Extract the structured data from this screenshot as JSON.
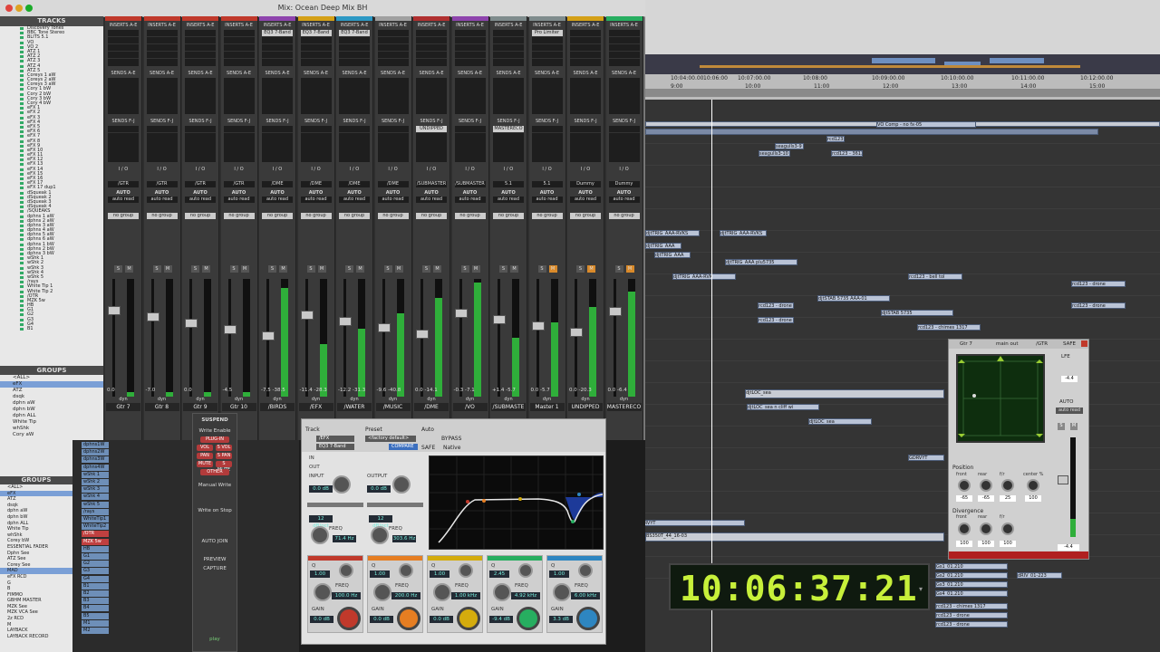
{
  "mix_window": {
    "title": "Mix: Ocean Deep Mix BH",
    "tracks_header": "TRACKS",
    "groups_header": "GROUPS",
    "tracks": [
      "Discovery Tones",
      "BBC Tone Stereo",
      "BLITS 5.1",
      "VO",
      "VO 2",
      "ATZ 1",
      "ATZ 2",
      "ATZ 3",
      "ATZ 4",
      "ATZ 5",
      "Coreys 1 aW",
      "Coreys 2 aW",
      "Coreys 3 aW",
      "Cory 1 bW",
      "Cory 2 bW",
      "Cory 3 bW",
      "Cory 4 bW",
      "eFX 1",
      "eFX 2",
      "eFX 3",
      "eFX 4",
      "eFX 5",
      "eFX 6",
      "eFX 7",
      "eFX 8",
      "eFX 9",
      "eFX 10",
      "eFX 11",
      "eFX 12",
      "eFX 13",
      "eFX 14",
      "eFX 15",
      "eFX 16",
      "eFX 17",
      "eFX 17 dup1",
      "dSqueak 1",
      "dSqueak 2",
      "dSqueak 3",
      "dSqueak 4",
      "/SQUEAKS",
      "dphns 1 aW",
      "dphns 2 aW",
      "dphns 3 aW",
      "dphns 4 aW",
      "dphns 5 aW",
      "dphns 6 aW",
      "dphns 1 bW",
      "dphns 2 bW",
      "dphns 3 bW",
      "wShk 1",
      "wShk 2",
      "wShk 3",
      "wShk 4",
      "wShk 5",
      "/rays",
      "White Tip 1",
      "White Tip 2",
      "/OTR",
      "MZK 5w",
      "HB",
      "G1",
      "G2",
      "G3",
      "G4",
      "B1"
    ],
    "groups": [
      "<ALL>",
      "eFX",
      "ATZ",
      "dsqk",
      "dphn aW",
      "dphn bW",
      "dphn ALL",
      "White Tip",
      "whShk",
      "Cory aW"
    ],
    "strips": [
      {
        "name": "Gtr 7",
        "color": "#c0392b",
        "volume": "0.0",
        "insert": "",
        "send": "",
        "output": "/GTR",
        "auto": "AUTO",
        "autoread": "auto read",
        "group": "no group"
      },
      {
        "name": "Gtr 8",
        "color": "#c0392b",
        "volume": "-7.0",
        "insert": "",
        "send": "",
        "output": "/GTR",
        "auto": "AUTO",
        "autoread": "auto read",
        "group": "no group"
      },
      {
        "name": "Gtr 9",
        "color": "#c0392b",
        "volume": "0.0",
        "insert": "",
        "send": "",
        "output": "/GTR",
        "auto": "AUTO",
        "autoread": "auto read",
        "group": "no group"
      },
      {
        "name": "Gtr 10",
        "color": "#c0392b",
        "volume": "-4.5",
        "insert": "",
        "send": "",
        "output": "/GTR",
        "auto": "AUTO",
        "autoread": "auto read",
        "group": "no group"
      },
      {
        "name": "/BIRDS",
        "color": "#8e44ad",
        "volume": "-7.5 -38.5",
        "insert": "EQ3 7-Band",
        "send": "",
        "output": "/DME",
        "auto": "AUTO",
        "autoread": "auto read",
        "group": "no group"
      },
      {
        "name": "/EFX",
        "color": "#d4a017",
        "volume": "-11.4 -28.3",
        "insert": "EQ3 7-Band",
        "send": "",
        "output": "/DME",
        "auto": "AUTO",
        "autoread": "auto read",
        "group": "no group"
      },
      {
        "name": "/WATER",
        "color": "#2c98c4",
        "volume": "-12.2 -31.3",
        "insert": "EQ3 7-Band",
        "send": "",
        "output": "/DME",
        "auto": "AUTO",
        "autoread": "auto read",
        "group": "no group"
      },
      {
        "name": "/MUSIC",
        "color": "#a0a0a0",
        "volume": "-9.6 -40.8",
        "insert": "",
        "send": "",
        "output": "/DME",
        "auto": "AUTO",
        "autoread": "auto read",
        "group": "no group"
      },
      {
        "name": "/DME",
        "color": "#b03030",
        "volume": "0.0 -14.1",
        "insert": "",
        "send": "UNDIPPED",
        "output": "/SUBMASTER",
        "auto": "AUTO",
        "autoread": "auto read",
        "group": "no group"
      },
      {
        "name": "/VO",
        "color": "#8e44ad",
        "volume": "-0.3 -7.1",
        "insert": "",
        "send": "",
        "output": "/SUBMASTER",
        "auto": "AUTO",
        "autoread": "auto read",
        "group": "no group"
      },
      {
        "name": "/SUBMASTE",
        "color": "#7f8c8d",
        "volume": "+1.4 -5.7",
        "insert": "",
        "send": "MASTERECO",
        "output": "5.1",
        "auto": "AUTO",
        "autoread": "auto read",
        "group": "no group"
      },
      {
        "name": "Master 1",
        "color": "#7f8c8d",
        "volume": "0.0 -5.7",
        "insert": "Pro Limiter",
        "send": "",
        "output": "5.1",
        "auto": "AUTO",
        "autoread": "auto read",
        "group": "no group"
      },
      {
        "name": "UNDIPPED",
        "color": "#d4a017",
        "volume": "0.0 -20.3",
        "insert": "",
        "send": "",
        "output": "Dummy",
        "auto": "AUTO",
        "autoread": "auto read",
        "group": "no group"
      },
      {
        "name": "MASTERECO",
        "color": "#27ae60",
        "volume": "0.0 -6.4",
        "insert": "",
        "send": "",
        "output": "Dummy",
        "auto": "AUTO",
        "autoread": "auto read",
        "group": "no group"
      }
    ],
    "labels": {
      "inserts": "INSERTS A-E",
      "sends_ae": "SENDS A-E",
      "sends_fj": "SENDS F-J",
      "io": "I / O",
      "vol": "vol",
      "dyn": "dyn"
    }
  },
  "lower_window": {
    "groups_header": "GROUPS",
    "groups": [
      "<ALL>",
      "eFX",
      "ATZ",
      "dsqk",
      "dphn aW",
      "dphn bW",
      "dphn ALL",
      "White Tip",
      "whShk",
      "Corey bW",
      "ESSENTIAL FADER",
      "Dphn See",
      "ATZ See",
      "Corey See",
      "MAD",
      "eFX RCD",
      "G",
      "B",
      "FIMMO",
      "GBHM MASTER",
      "MZK See",
      "MZK VCA See",
      "2z RCD",
      "M",
      "LAYBACK",
      "LAYBACK RECORD"
    ],
    "tracks": [
      "dphns1W",
      "dphns2W",
      "dphns3W",
      "dphns4W",
      "wShk 1",
      "wShk 2",
      "wShk 3",
      "wShk 4",
      "wShk 5",
      "/rays",
      "WhiteTip1",
      "WhiteTip2",
      "/OTR",
      "MZK 5w",
      "HB",
      "G1",
      "G2",
      "G3",
      "G4",
      "B1",
      "B2",
      "B3",
      "B4",
      "B5",
      "M1",
      "M2"
    ],
    "automation": {
      "suspend": "SUSPEND",
      "write_enable": "Write Enable",
      "plugin": "PLUG-IN",
      "vol": "VOL",
      "s_vol": "S VOL",
      "pan": "PAN",
      "s_pan": "S PAN",
      "mute": "MUTE",
      "s_mute": "S MUTE",
      "other": "OTHER",
      "manual_write": "Manual Write",
      "write_on_stop": "Write on Stop",
      "auto_join": "AUTO JOIN",
      "preview": "PREVIEW",
      "capture": "CAPTURE",
      "play": "play",
      "volume": "volume"
    }
  },
  "eq_plugin": {
    "track_label": "Track",
    "preset_label": "Preset",
    "auto_label": "Auto",
    "track": "/EFX",
    "preset": "<factory default>",
    "insert": "EQ3 7-Band",
    "bypass": "BYPASS",
    "compare": "COMPARE",
    "safe": "SAFE",
    "native": "Native",
    "input_label": "INPUT",
    "output_label": "OUTPUT",
    "input": "0.0 dB",
    "output": "0.0 dB",
    "hpf": {
      "slope": "12 dB/oct",
      "freq": "71.4 Hz"
    },
    "lpf": {
      "slope": "12 dB/oct",
      "freq": "303.6 Hz"
    },
    "bands": [
      {
        "q": "1.00",
        "freq": "100.0 Hz",
        "gain": "0.0 dB",
        "color": "#c0392b"
      },
      {
        "q": "1.00",
        "freq": "200.0 Hz",
        "gain": "0.0 dB",
        "color": "#e67e22"
      },
      {
        "q": "1.00",
        "freq": "1.00 kHz",
        "gain": "0.0 dB",
        "color": "#d4ac0d"
      },
      {
        "q": "2.45",
        "freq": "4.92 kHz",
        "gain": "-9.4 dB",
        "color": "#27ae60"
      },
      {
        "q": "1.00",
        "freq": "6.00 kHz",
        "gain": "3.3 dB",
        "color": "#2e86c1"
      }
    ],
    "labels": {
      "q": "Q",
      "freq": "FREQ",
      "gain": "GAIN",
      "in": "IN",
      "out": "OUT"
    }
  },
  "panner": {
    "track": "Gtr 7",
    "output": "main out",
    "out2": "/GTR",
    "safe": "SAFE",
    "lfe": "LFE",
    "auto": "AUTO",
    "autoread": "auto read",
    "position": "Position",
    "front": "front",
    "rear": "rear",
    "fr": "f/r",
    "center": "center %",
    "values_pos": [
      "-65",
      "-65",
      "25",
      "100"
    ],
    "divergence": "Divergence",
    "div_front": "front",
    "div_rear": "rear",
    "div_fr": "f/r",
    "values_div": [
      "100",
      "100",
      "100"
    ],
    "lfe_val": "-4.4"
  },
  "timecode": {
    "display": "10:06:37:21"
  },
  "edit_window": {
    "ruler_times": [
      "10:04:00.00",
      "10:06:00",
      "10:07:00.00",
      "10:08:00",
      "10:09:00.00",
      "10:10:00.00",
      "10:11:00.00",
      "10:12:00.00"
    ],
    "ruler_times2": [
      "9:00",
      "10:00",
      "11:00",
      "12:00",
      "13:00",
      "14:00",
      "15:00"
    ],
    "clips": [
      "VO Comp - no fx-05",
      "seagulls3-9",
      "seagulls3-10",
      "rcd123",
      "rcd123 - 3613",
      "djtTRIG_AAA-RVKS",
      "djtTRIG_AAA",
      "djtTRIG_AAA-RVK",
      "djtTRIG_AAA plu5735",
      "djtSTAB 5735",
      "djtSTAB 5735 AAA-01",
      "djtLOC_sea",
      "djtLOC_sea n cliff wi",
      "GDRVYT",
      "BS350T_44_16-03",
      "rcd123 - drone",
      "rcd123 - chimes 1317",
      "rcd123 - bell tol",
      "Gs1_01.210",
      "Gs2_01.210",
      "Gs3_01.210",
      "Gs4_01.210",
      "dRIV_01-223"
    ]
  }
}
